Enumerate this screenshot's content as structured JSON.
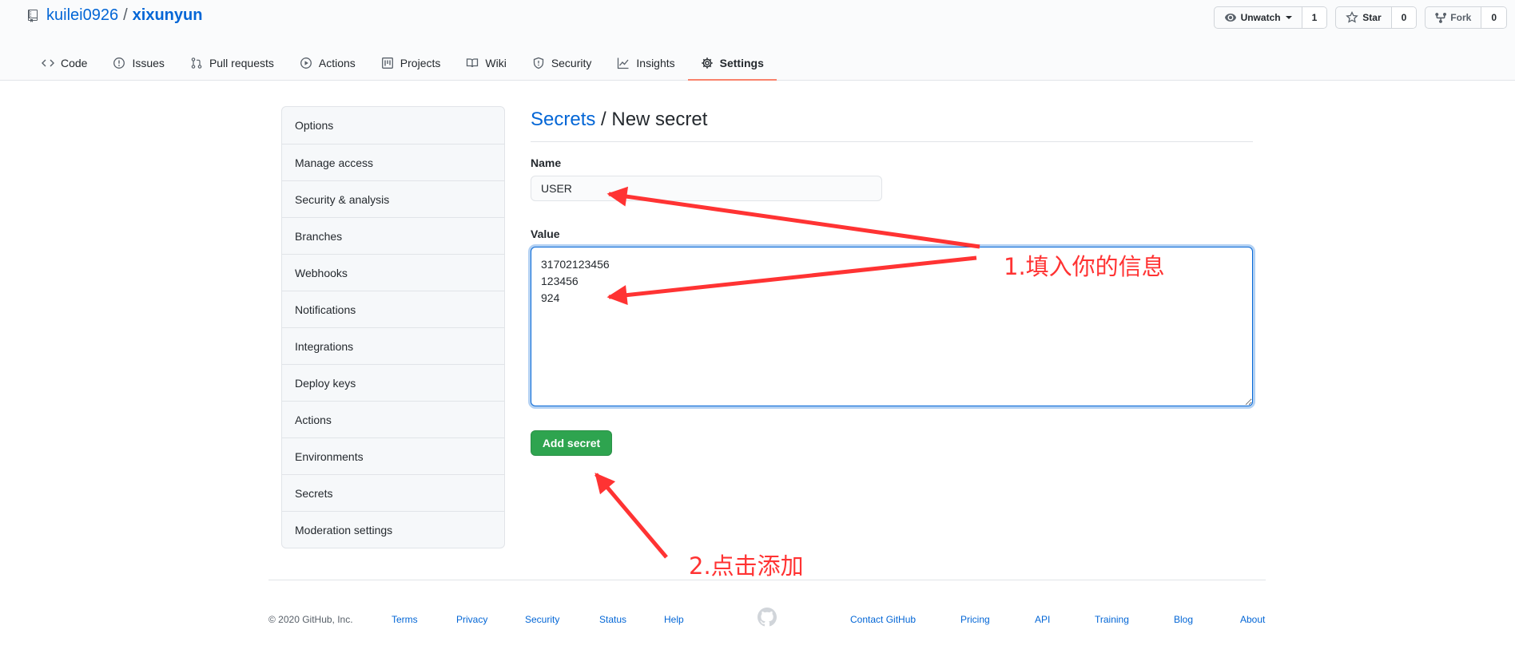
{
  "repo": {
    "owner": "kuilei0926",
    "separator": "/",
    "name": "xixunyun"
  },
  "actions": {
    "watch": {
      "label": "Unwatch",
      "count": "1"
    },
    "star": {
      "label": "Star",
      "count": "0"
    },
    "fork": {
      "label": "Fork",
      "count": "0"
    }
  },
  "tabs": [
    {
      "label": "Code",
      "icon": "code-icon"
    },
    {
      "label": "Issues",
      "icon": "issue-icon"
    },
    {
      "label": "Pull requests",
      "icon": "pull-request-icon"
    },
    {
      "label": "Actions",
      "icon": "play-icon"
    },
    {
      "label": "Projects",
      "icon": "project-icon"
    },
    {
      "label": "Wiki",
      "icon": "book-icon"
    },
    {
      "label": "Security",
      "icon": "shield-icon"
    },
    {
      "label": "Insights",
      "icon": "graph-icon"
    },
    {
      "label": "Settings",
      "icon": "gear-icon",
      "selected": true
    }
  ],
  "sidebar": {
    "items": [
      "Options",
      "Manage access",
      "Security & analysis",
      "Branches",
      "Webhooks",
      "Notifications",
      "Integrations",
      "Deploy keys",
      "Actions",
      "Environments",
      "Secrets",
      "Moderation settings"
    ]
  },
  "form": {
    "breadcrumb_link": "Secrets",
    "breadcrumb_rest": " / New secret",
    "name_label": "Name",
    "name_value": "USER",
    "value_label": "Value",
    "value_text": "31702123456\n123456\n924",
    "submit_label": "Add secret"
  },
  "annotations": {
    "note1": "1.填入你的信息",
    "note2": "2.点击添加",
    "color": "#ff3333"
  },
  "footer": {
    "copyright": "© 2020 GitHub, Inc.",
    "left_links": [
      "Terms",
      "Privacy",
      "Security",
      "Status",
      "Help"
    ],
    "right_links": [
      "Contact GitHub",
      "Pricing",
      "API",
      "Training",
      "Blog",
      "About"
    ]
  },
  "colors": {
    "link": "#0366d6",
    "primary_button": "#2ea44f",
    "tab_underline": "#f9826c"
  }
}
